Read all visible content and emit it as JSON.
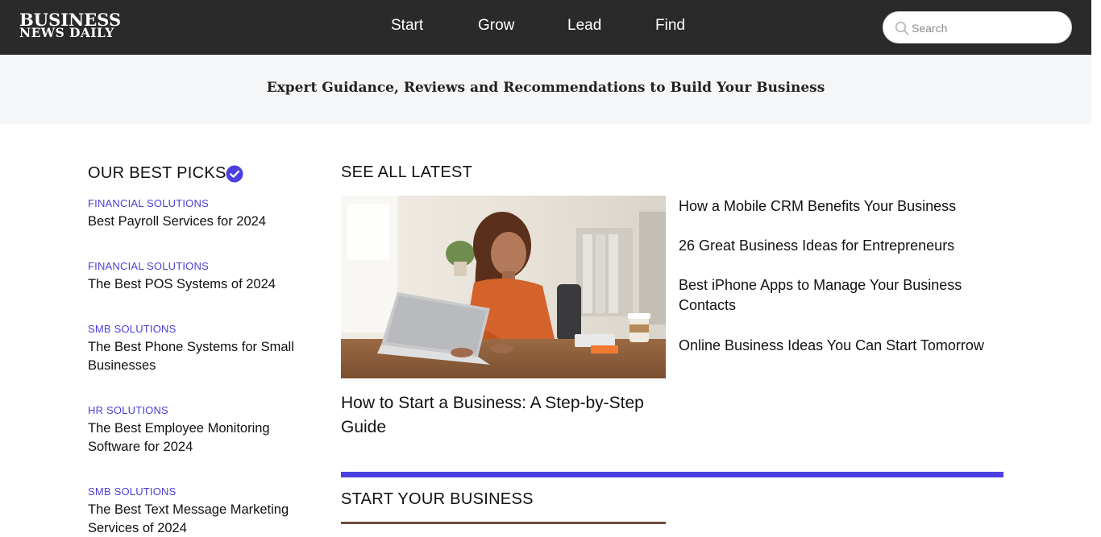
{
  "header": {
    "logo_line1": "BUSINESS",
    "logo_line2": "NEWS DAILY",
    "nav": [
      {
        "label": "Start"
      },
      {
        "label": "Grow"
      },
      {
        "label": "Lead"
      },
      {
        "label": "Find"
      }
    ],
    "search": {
      "placeholder": "Search",
      "icon": "search-icon"
    }
  },
  "tagline": "Expert Guidance, Reviews and Recommendations to Build Your Business",
  "best_picks": {
    "title": "OUR BEST PICKS",
    "badge_icon": "verified-check-icon",
    "items": [
      {
        "category": "FINANCIAL SOLUTIONS",
        "title": "Best Payroll Services for 2024"
      },
      {
        "category": "FINANCIAL SOLUTIONS",
        "title": "The Best POS Systems of 2024"
      },
      {
        "category": "SMB SOLUTIONS",
        "title": "The Best Phone Systems for Small Businesses"
      },
      {
        "category": "HR SOLUTIONS",
        "title": "The Best Employee Monitoring Software for 2024"
      },
      {
        "category": "SMB SOLUTIONS",
        "title": "The Best Text Message Marketing Services of 2024"
      }
    ]
  },
  "latest": {
    "title": "SEE ALL LATEST",
    "feature": {
      "headline": "How to Start a Business: A Step-by-Step Guide"
    },
    "links": [
      {
        "title": "How a Mobile CRM Benefits Your Business"
      },
      {
        "title": "26 Great Business Ideas for Entrepreneurs"
      },
      {
        "title": "Best iPhone Apps to Manage Your Business Contacts"
      },
      {
        "title": "Online Business Ideas You Can Start Tomorrow"
      }
    ]
  },
  "start_section": {
    "title": "START YOUR BUSINESS"
  },
  "colors": {
    "header_bg": "#2a2a2a",
    "accent": "#4b3fe0",
    "category": "#4b3fd6",
    "band_bg": "#f5f6f8"
  }
}
